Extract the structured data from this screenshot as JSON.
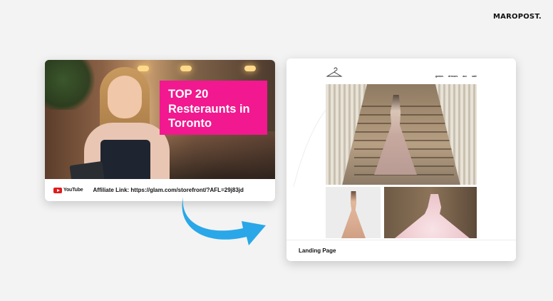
{
  "brand": {
    "logo": "MAROPOST."
  },
  "left_card": {
    "headline_lines": [
      "TOP 20",
      "Resteraunts in",
      "Toronto"
    ],
    "headline_bg": "#f2188f",
    "platform": {
      "icon": "youtube-icon",
      "label": "YouTube"
    },
    "affiliate_link": "Affiliate Link: https://glam.com/storefront/?AFL=29j83jd"
  },
  "arrow": {
    "color": "#2aa7e8",
    "icon": "curved-arrow-icon"
  },
  "right_card": {
    "logo_icon": "hanger-icon",
    "nav_items": [
      "gowns",
      "dresses",
      "acc",
      "sale"
    ],
    "caption": "Landing Page"
  }
}
